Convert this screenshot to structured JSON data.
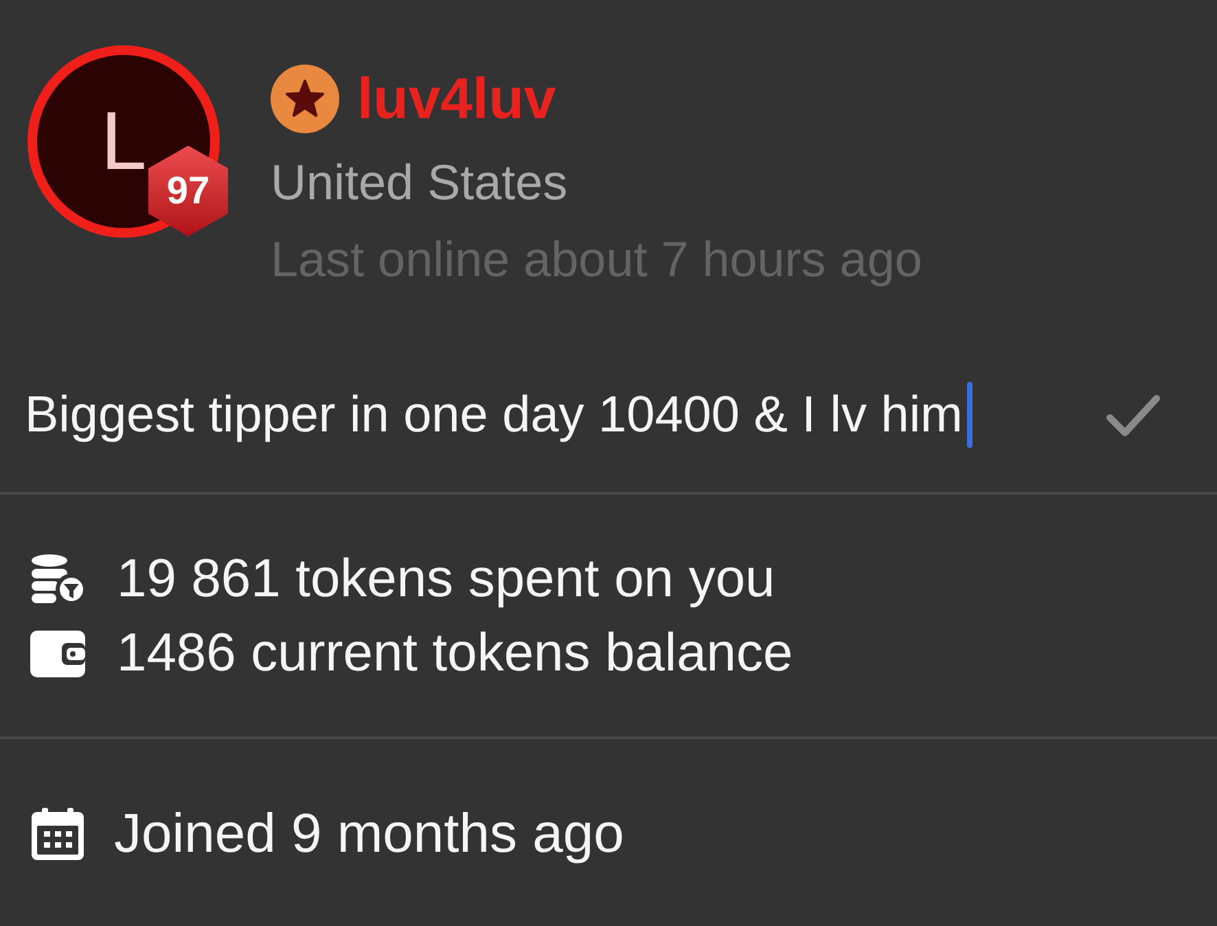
{
  "profile": {
    "avatar": {
      "initial": "L",
      "level_badge": "97"
    },
    "username": "luv4luv",
    "country": "United States",
    "last_online": "Last online about 7 hours ago"
  },
  "note": {
    "value": "Biggest tipper in one day 10400 & I lv him",
    "focused": true
  },
  "stats": [
    {
      "kind": "spent",
      "text": "19 861 tokens spent on you"
    },
    {
      "kind": "balance",
      "text": "1486 current tokens balance"
    }
  ],
  "joined": {
    "text": "Joined 9 months ago"
  }
}
